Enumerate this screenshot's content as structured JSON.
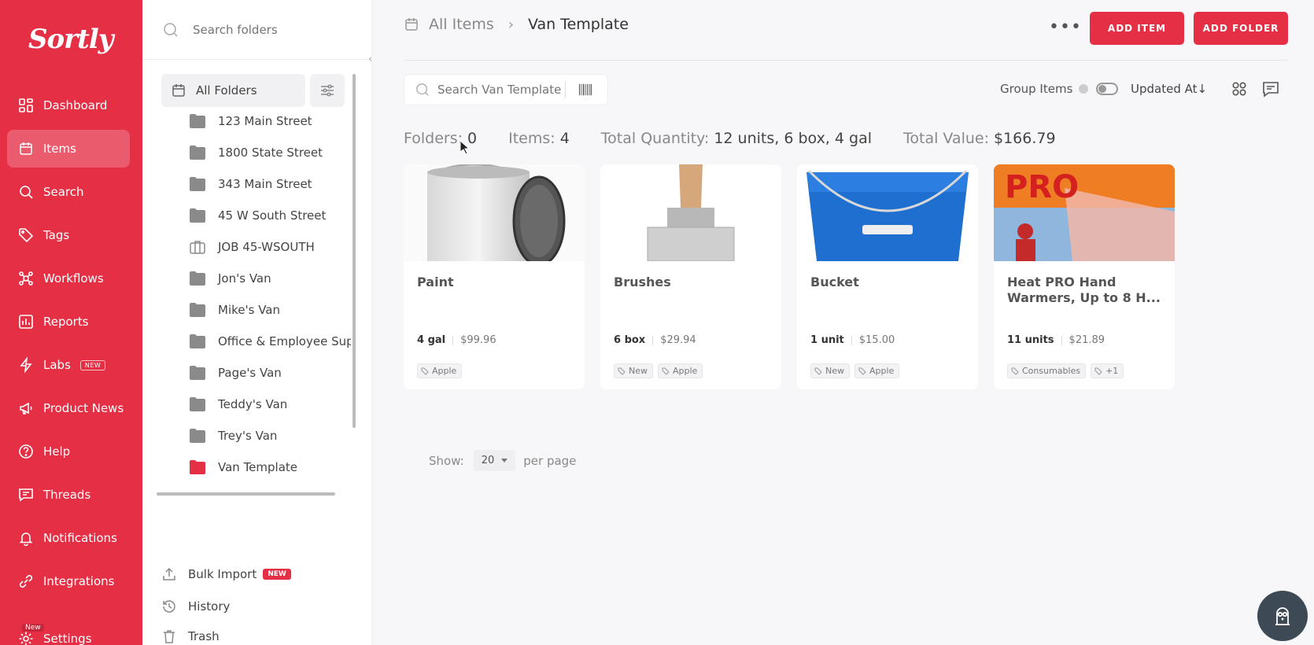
{
  "brand": {
    "logo_text": "Sortly",
    "accent": "#e42f45"
  },
  "nav": {
    "items": [
      {
        "label": "Dashboard",
        "icon": "dashboard-icon"
      },
      {
        "label": "Items",
        "icon": "items-icon",
        "active": true
      },
      {
        "label": "Search",
        "icon": "search-icon"
      },
      {
        "label": "Tags",
        "icon": "tag-icon"
      },
      {
        "label": "Workflows",
        "icon": "workflows-icon"
      },
      {
        "label": "Reports",
        "icon": "reports-icon"
      },
      {
        "label": "Labs",
        "icon": "labs-icon",
        "badge": "NEW"
      },
      {
        "label": "Product News",
        "icon": "megaphone-icon"
      },
      {
        "label": "Help",
        "icon": "help-icon"
      },
      {
        "label": "Threads",
        "icon": "threads-icon"
      },
      {
        "label": "Notifications",
        "icon": "bell-icon"
      },
      {
        "label": "Integrations",
        "icon": "integrations-icon"
      },
      {
        "label": "Settings",
        "icon": "gear-icon",
        "badge": "New"
      }
    ]
  },
  "folders": {
    "search_placeholder": "Search folders",
    "all_folders_label": "All Folders",
    "list": [
      "123 Main Street",
      "1800 State Street",
      "343 Main Street",
      "45 W South Street",
      "JOB 45-WSOUTH",
      "Jon's Van",
      "Mike's Van",
      "Office & Employee Suppli",
      "Page's Van",
      "Teddy's Van",
      "Trey's Van",
      "Van Template"
    ],
    "bulk_import": "Bulk Import",
    "bulk_import_badge": "NEW",
    "history": "History",
    "trash": "Trash"
  },
  "header": {
    "breadcrumb_root": "All Items",
    "breadcrumb_current": "Van Template",
    "add_item": "ADD ITEM",
    "add_folder": "ADD FOLDER"
  },
  "toolbar": {
    "search_placeholder": "Search Van Template",
    "group_items": "Group Items",
    "sort_label": "Updated At↓"
  },
  "summary": {
    "folders_label": "Folders:",
    "folders_value": "0",
    "items_label": "Items:",
    "items_value": "4",
    "quantity_label": "Total Quantity:",
    "quantity_value": "12 units, 6 box, 4 gal",
    "value_label": "Total Value:",
    "value_value": "$166.79"
  },
  "items": [
    {
      "name": "Paint",
      "qty": "4 gal",
      "price": "$99.96",
      "tags": [
        "Apple"
      ]
    },
    {
      "name": "Brushes",
      "qty": "6 box",
      "price": "$29.94",
      "tags": [
        "New",
        "Apple"
      ]
    },
    {
      "name": "Bucket",
      "qty": "1 unit",
      "price": "$15.00",
      "tags": [
        "New",
        "Apple"
      ]
    },
    {
      "name": "Heat PRO Hand Warmers, Up to 8 H...",
      "qty": "11 units",
      "price": "$21.89",
      "tags": [
        "Consumables",
        "+1"
      ]
    }
  ],
  "pagination": {
    "show_label": "Show:",
    "per_page_value": "20",
    "per_page_label": "per page"
  }
}
